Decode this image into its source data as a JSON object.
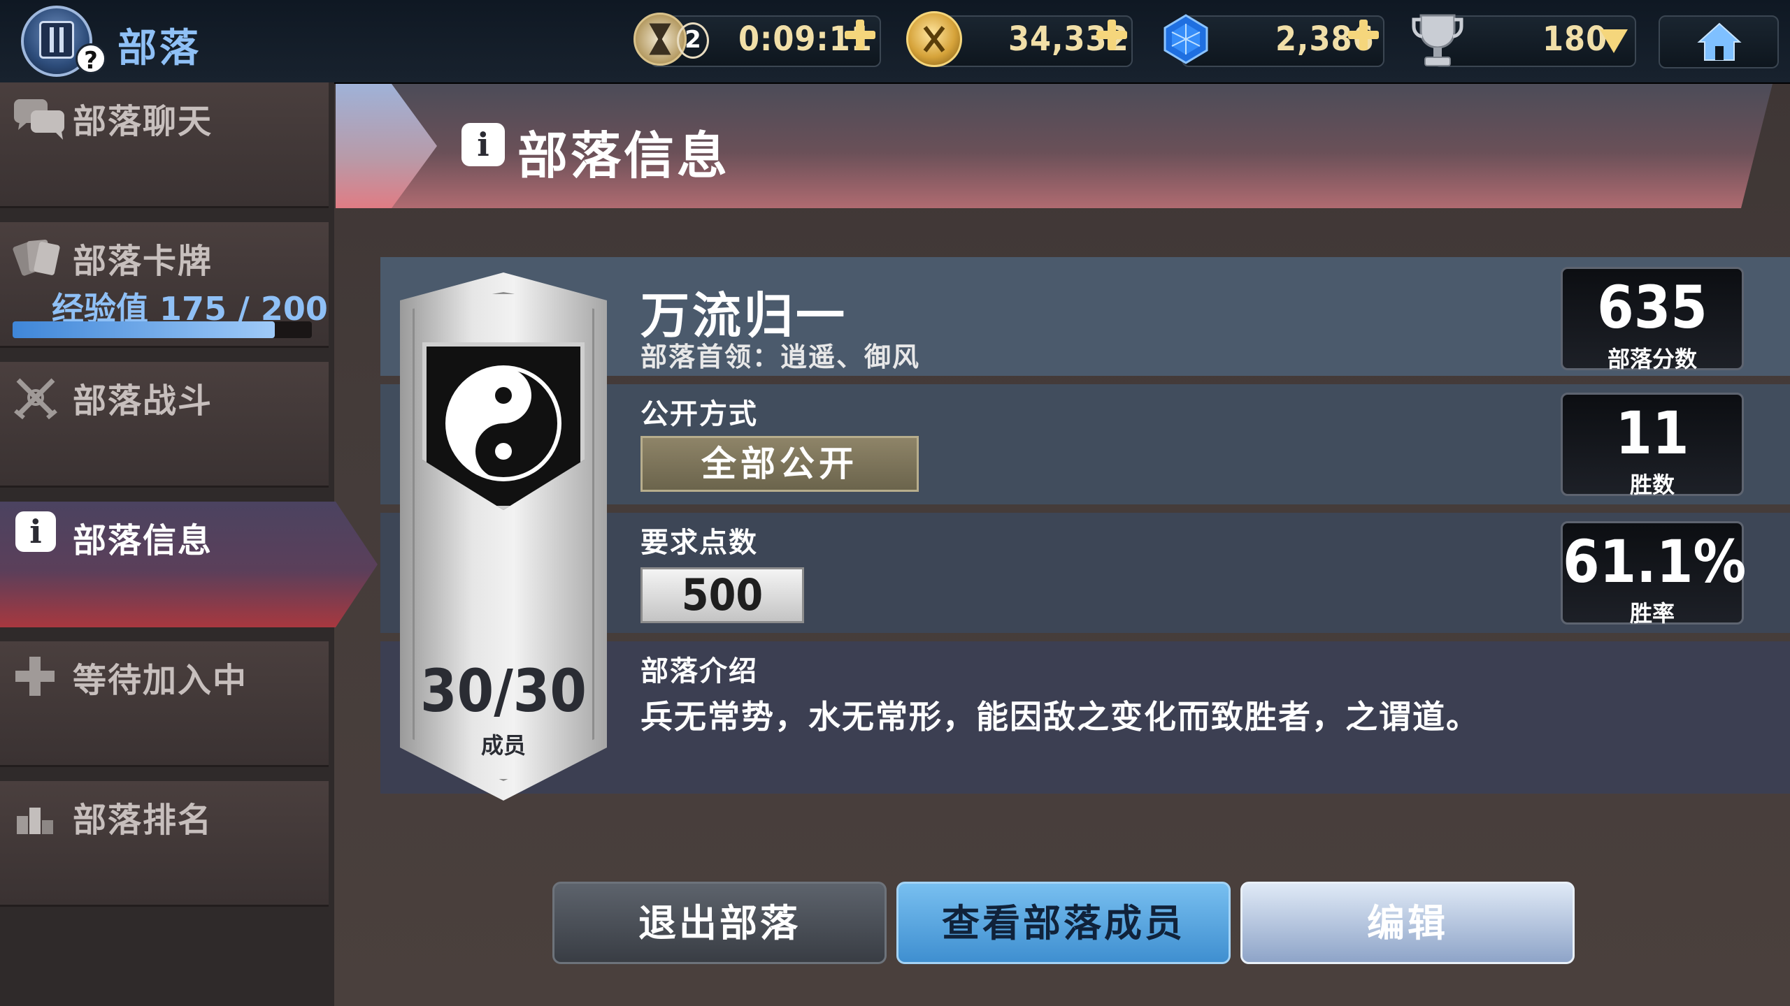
{
  "topbar": {
    "title": "部落",
    "help_badge": "?",
    "timer": {
      "count": "2",
      "value": "0:09:11"
    },
    "gold": {
      "value": "34,332",
      "icon": "coin-icon"
    },
    "gems": {
      "value": "2,386",
      "icon": "gem-icon"
    },
    "trophies": {
      "value": "180",
      "icon": "trophy-icon"
    }
  },
  "sidebar": {
    "items": [
      {
        "label": "部落聊天",
        "icon": "chat-icon"
      },
      {
        "label": "部落卡牌",
        "icon": "cards-icon",
        "exp_label": "经验值 175 / 200",
        "exp_progress": 0.875
      },
      {
        "label": "部落战斗",
        "icon": "crossed-swords-icon"
      },
      {
        "label": "部落信息",
        "icon": "info-icon",
        "active": true
      },
      {
        "label": "等待加入中",
        "icon": "plus-icon"
      },
      {
        "label": "部落排名",
        "icon": "ranking-icon"
      }
    ]
  },
  "header": {
    "title": "部落信息",
    "info_glyph": "i"
  },
  "clan": {
    "name": "万流归一",
    "leader_line": "部落首领：逍遥、御风",
    "members": "30/30",
    "members_label": "成员",
    "privacy_label": "公开方式",
    "privacy_value": "全部公开",
    "points_label": "要求点数",
    "points_value": "500",
    "desc_label": "部落介绍",
    "description": "兵无常势，水无常形，能因敌之变化而致胜者，之谓道。"
  },
  "stats": {
    "score": {
      "value": "635",
      "label": "部落分数"
    },
    "wins": {
      "value": "11",
      "label": "胜数"
    },
    "winrate": {
      "value": "61.1%",
      "label": "胜率"
    }
  },
  "buttons": {
    "quit": "退出部落",
    "members": "查看部落成员",
    "edit": "编辑"
  }
}
